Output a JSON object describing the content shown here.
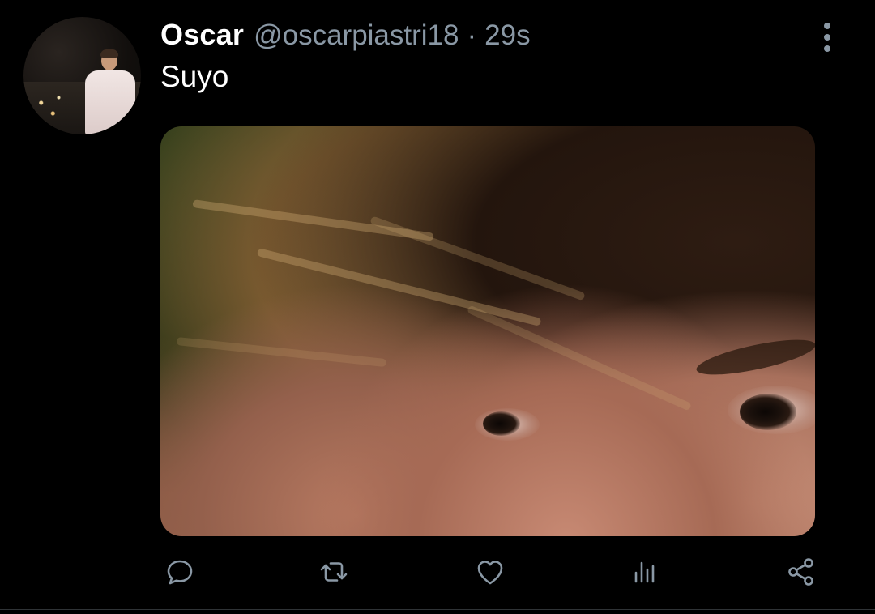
{
  "tweet": {
    "author_name": "Oscar",
    "handle": "@oscarpiastri18",
    "separator": "·",
    "timestamp": "29s",
    "text": "Suyo"
  },
  "icons": {
    "more": "more-vertical-icon",
    "reply": "reply-icon",
    "retweet": "retweet-icon",
    "like": "heart-icon",
    "analytics": "analytics-icon",
    "share": "share-icon"
  },
  "colors": {
    "background": "#000000",
    "primary_text": "#ffffff",
    "secondary_text": "#8a98a5",
    "divider": "#2f3336"
  }
}
